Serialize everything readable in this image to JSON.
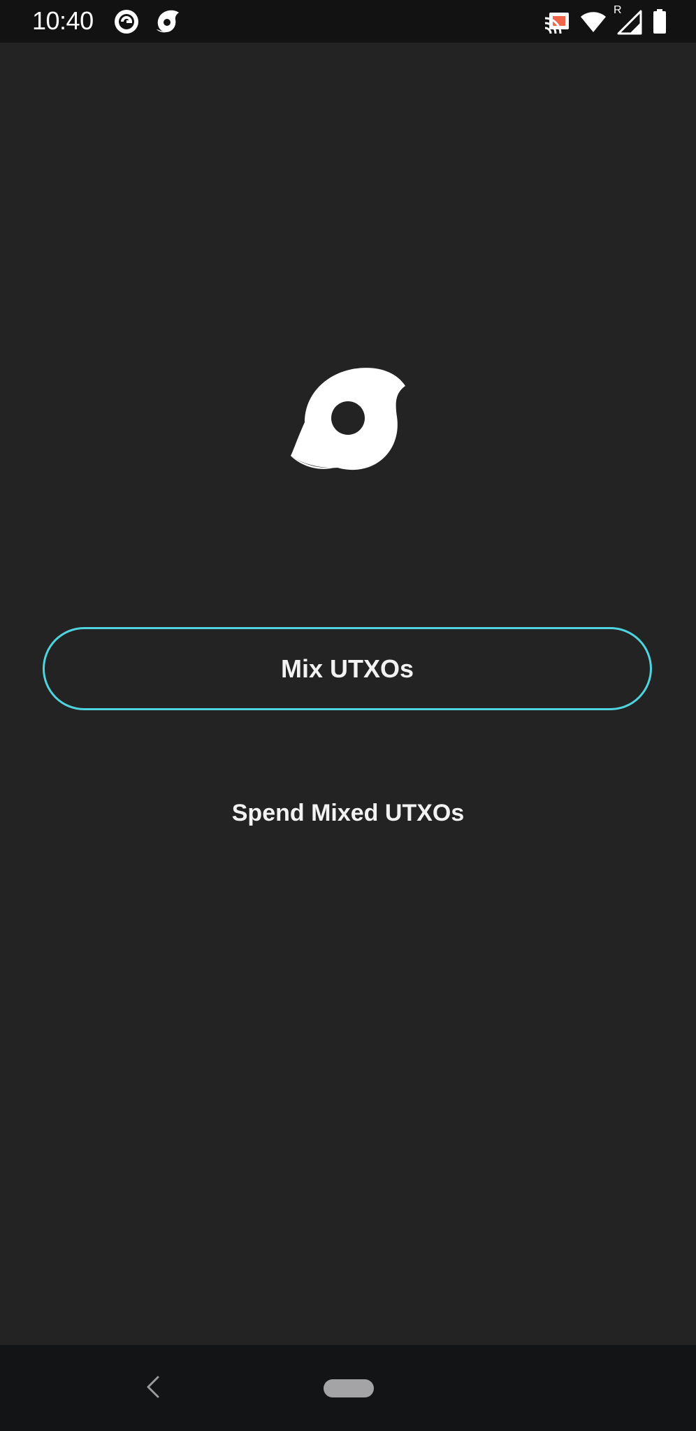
{
  "status_bar": {
    "time": "10:40",
    "left_icons": [
      "notification-app-icon",
      "notification-whirlpool-icon"
    ],
    "right_icons": [
      "cast-icon",
      "wifi-icon",
      "cell-signal-roaming-icon",
      "battery-icon"
    ],
    "roaming_indicator": "R",
    "cast_accent_color": "#f0664a"
  },
  "main": {
    "logo_icon": "whirlpool-logo-icon",
    "primary_button_label": "Mix UTXOs",
    "secondary_button_label": "Spend Mixed UTXOs",
    "accent_color": "#4fd3de",
    "background_color": "#232323"
  },
  "nav_bar": {
    "back_icon": "back-chevron-icon",
    "home_icon": "home-pill-icon"
  }
}
